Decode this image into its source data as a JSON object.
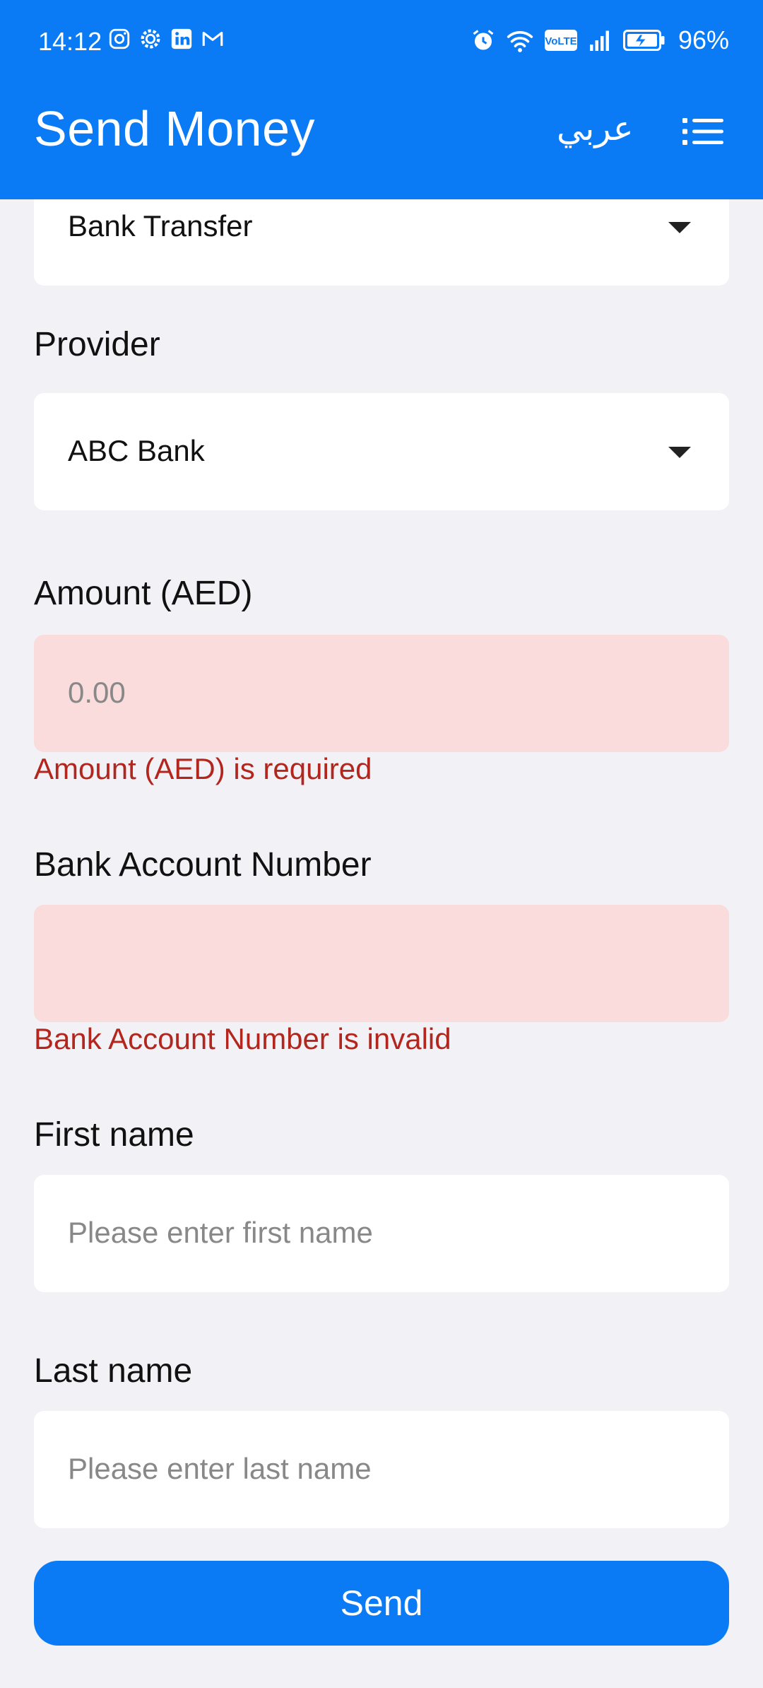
{
  "status_bar": {
    "time": "14:12",
    "left_icons": [
      "instagram-icon",
      "settings-gear-icon",
      "linkedin-icon",
      "gmail-icon"
    ],
    "right_icons": [
      "alarm-icon",
      "wifi-icon",
      "volte-icon",
      "signal-icon",
      "battery-icon"
    ],
    "volte_label": "VoLTE",
    "battery": "96%"
  },
  "header": {
    "title": "Send Money",
    "language_toggle": "عربي",
    "menu_icon": "list-menu-icon",
    "background": "#0a7af5"
  },
  "form": {
    "transfer_type": {
      "value": "Bank Transfer"
    },
    "provider": {
      "label": "Provider",
      "value": "ABC Bank"
    },
    "amount": {
      "label": "Amount (AED)",
      "placeholder": "0.00",
      "error": "Amount (AED) is required"
    },
    "bank_account": {
      "label": "Bank Account Number",
      "value": "",
      "error": "Bank Account Number is invalid"
    },
    "first_name": {
      "label": "First name",
      "placeholder": "Please enter first name"
    },
    "last_name": {
      "label": "Last name",
      "placeholder": "Please enter last name"
    },
    "send_label": "Send"
  },
  "colors": {
    "accent": "#0a7af5",
    "error_text": "#b3261e",
    "error_field_bg": "#f9dcdb",
    "page_bg": "#f1f1f6"
  }
}
